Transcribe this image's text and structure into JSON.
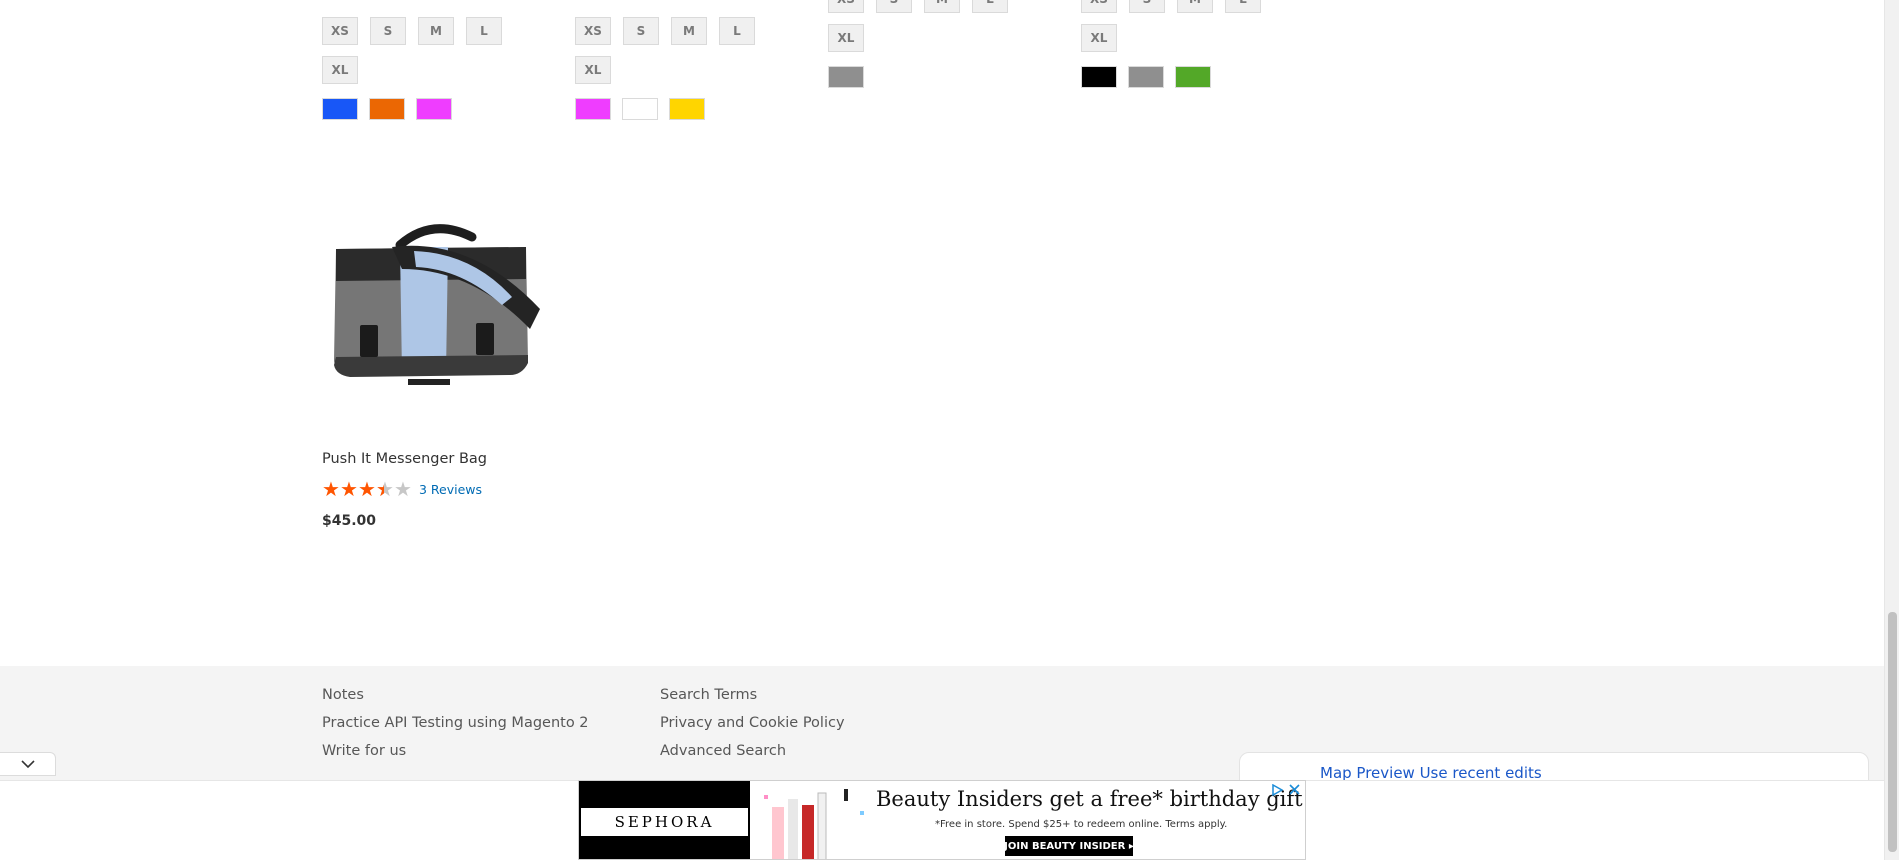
{
  "products_top": [
    {
      "sizes": [
        "XS",
        "S",
        "M",
        "L",
        "XL"
      ],
      "swatches": [
        "#1857f7",
        "#eb6703",
        "#ef3dff"
      ]
    },
    {
      "sizes": [
        "XS",
        "S",
        "M",
        "L",
        "XL"
      ],
      "swatches": [
        "#ef3dff",
        "#ffffff",
        "#ffd500"
      ]
    },
    {
      "sizes": [
        "XS",
        "S",
        "M",
        "L",
        "XL"
      ],
      "swatches": [
        "#8f8f8f"
      ]
    },
    {
      "sizes": [
        "XS",
        "S",
        "M",
        "L",
        "XL"
      ],
      "swatches": [
        "#000000",
        "#8f8f8f",
        "#53a828"
      ]
    }
  ],
  "featured_product": {
    "name": "Push It Messenger Bag",
    "rating_percent": 65,
    "reviews_label": "3 Reviews",
    "price": "$45.00"
  },
  "footer": {
    "col1": [
      "Notes",
      "Practice API Testing using Magento 2",
      "Write for us"
    ],
    "col2": [
      "Search Terms",
      "Privacy and Cookie Policy",
      "Advanced Search"
    ]
  },
  "partial_card_text": "Map  Preview  Use recent edits",
  "ad": {
    "brand": "SEPHORA",
    "headline": "Beauty Insiders get a free* birthday gift",
    "subtext": "*Free in store. Spend $25+ to redeem online. Terms apply.",
    "cta": "JOIN BEAUTY INSIDER ▸"
  },
  "colors": {
    "star": "#ff5501",
    "link": "#006bb4",
    "footer_bg": "#f4f4f4"
  }
}
